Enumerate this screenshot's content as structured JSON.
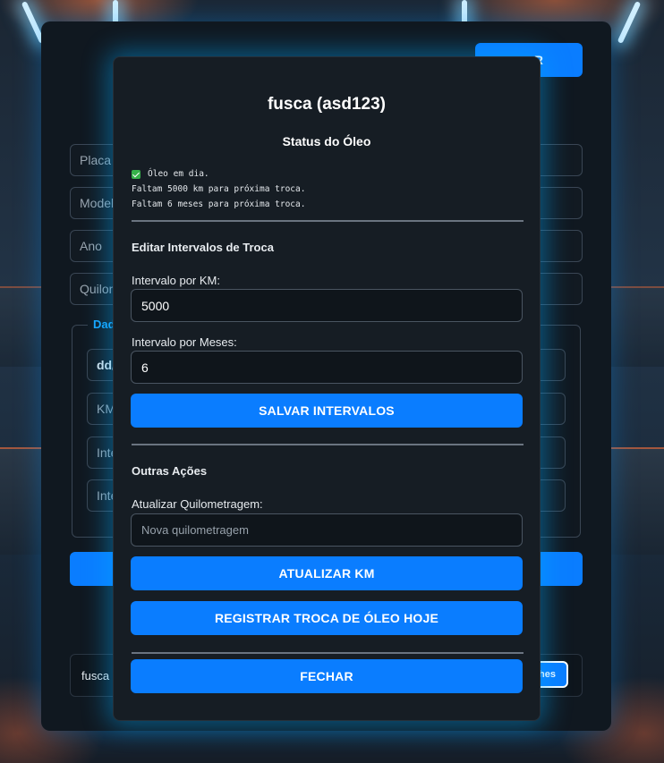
{
  "background": {
    "main_form": {
      "top_button_fragment": "R",
      "inputs": [
        "Placa",
        "Modelo",
        "Ano",
        "Quilom"
      ],
      "fieldset_legend": "Dad",
      "fieldset_inputs": [
        "dd/",
        "KM",
        "Inte",
        "Inte"
      ],
      "vehicle_row_text": "fusca (",
      "details_button_fragment": "hes"
    }
  },
  "modal": {
    "title": "fusca (asd123)",
    "status_heading": "Status do Óleo",
    "status_lines": [
      "Óleo em dia.",
      "Faltam 5000 km para próxima troca.",
      "Faltam 6 meses para próxima troca."
    ],
    "edit_section": {
      "title": "Editar Intervalos de Troca",
      "km_label": "Intervalo por KM:",
      "km_value": "5000",
      "months_label": "Intervalo por Meses:",
      "months_value": "6",
      "save_button": "SALVAR INTERVALOS"
    },
    "actions_section": {
      "title": "Outras Ações",
      "km_update_label": "Atualizar Quilometragem:",
      "km_update_placeholder": "Nova quilometragem",
      "update_button": "ATUALIZAR KM",
      "oil_change_button": "REGISTRAR TROCA DE ÓLEO HOJE"
    },
    "close_button": "FECHAR"
  },
  "colors": {
    "accent": "#0a7dff",
    "modal_bg": "#161d24",
    "glow": "#00aaff",
    "legend": "#19a7ff",
    "check": "#36b24a"
  }
}
